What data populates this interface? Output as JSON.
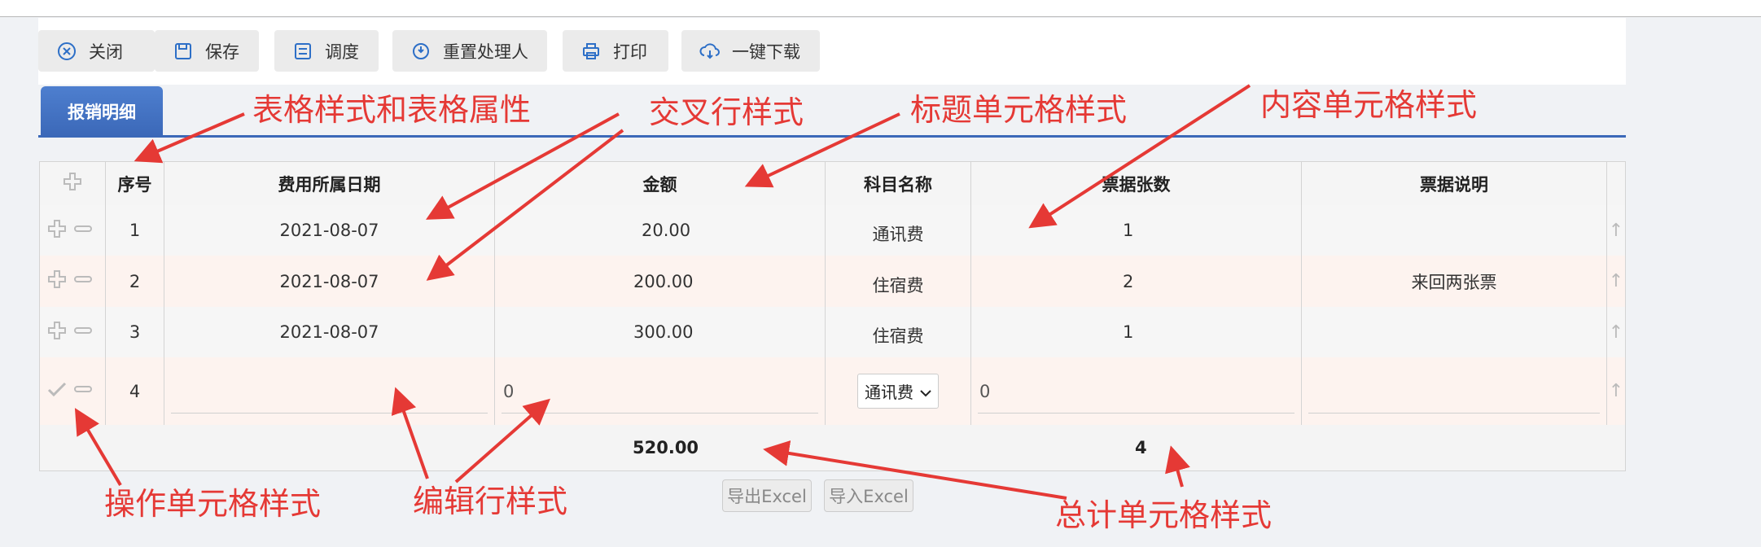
{
  "toolbar": {
    "close": "关闭",
    "save": "保存",
    "dispatch": "调度",
    "reset_handler": "重置处理人",
    "print": "打印",
    "download": "一键下载"
  },
  "tab": {
    "label": "报销明细"
  },
  "table": {
    "headers": [
      "序号",
      "费用所属日期",
      "金额",
      "科目名称",
      "票据张数",
      "票据说明"
    ],
    "rows": [
      {
        "no": "1",
        "date": "2021-08-07",
        "amount": "20.00",
        "subject": "通讯费",
        "count": "1",
        "note": ""
      },
      {
        "no": "2",
        "date": "2021-08-07",
        "amount": "200.00",
        "subject": "住宿费",
        "count": "2",
        "note": "来回两张票"
      },
      {
        "no": "3",
        "date": "2021-08-07",
        "amount": "300.00",
        "subject": "住宿费",
        "count": "1",
        "note": ""
      }
    ],
    "edit_row": {
      "no": "4",
      "date": "",
      "amount": "0",
      "subject": "通讯费",
      "count": "0",
      "note": ""
    },
    "totals": {
      "amount": "520.00",
      "count": "4"
    }
  },
  "buttons": {
    "export": "导出Excel",
    "import": "导入Excel"
  },
  "annotations": {
    "table_style": "表格样式和表格属性",
    "cross_row": "交叉行样式",
    "title_cell": "标题单元格样式",
    "content_cell": "内容单元格样式",
    "op_cell": "操作单元格样式",
    "edit_row": "编辑行样式",
    "total_cell": "总计单元格样式"
  },
  "colors": {
    "tab": "#3b68b8",
    "alt_row": "#fdf3ef",
    "annotation": "#e53935"
  }
}
